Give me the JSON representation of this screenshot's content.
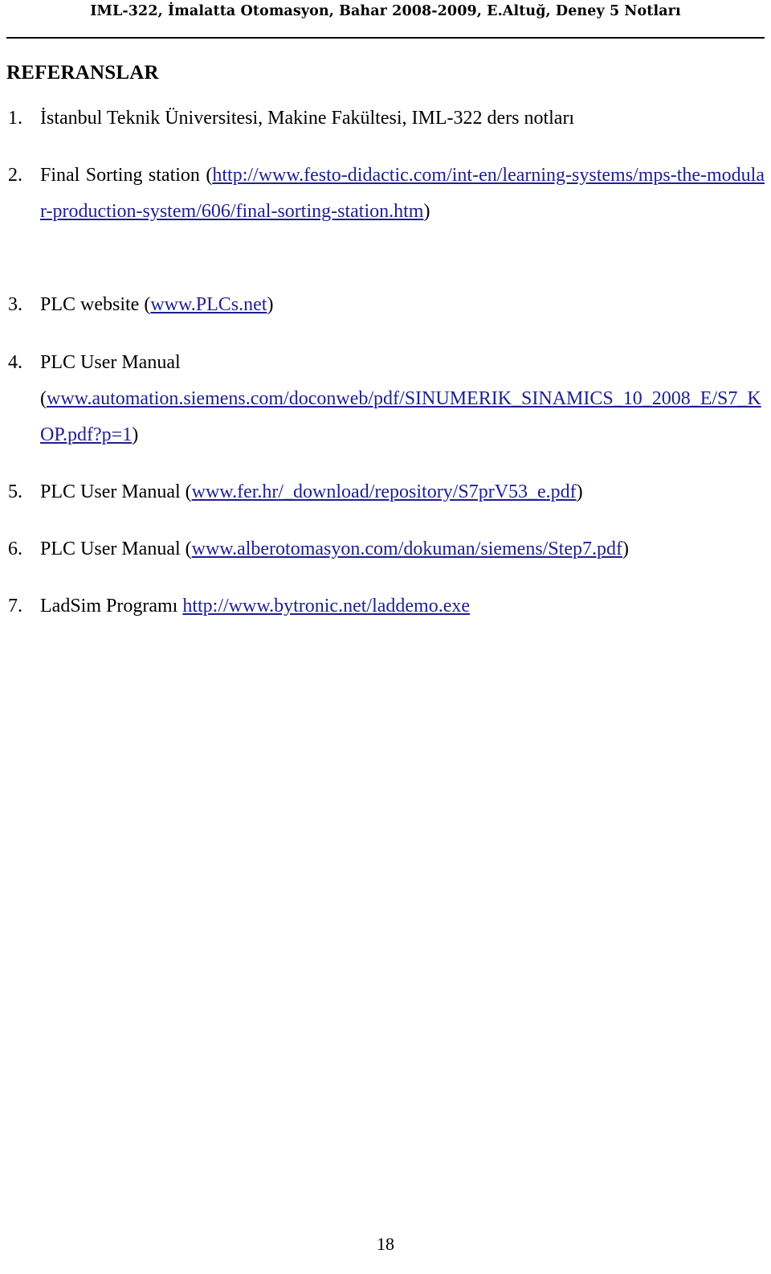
{
  "document": {
    "running_header": "IML-322, İmalatta Otomasyon, Bahar 2008-2009, E.Altuğ, Deney 5 Notları",
    "page_number": "18",
    "link_color": "#1f1f8f",
    "text_color": "#000000",
    "background_color": "#ffffff"
  },
  "section": {
    "title": "REFERANSLAR"
  },
  "references": [
    {
      "number": "1.",
      "text": "İstanbul Teknik Üniversitesi, Makine Fakültesi, IML-322 ders notları",
      "pre": "İstanbul Teknik Üniversitesi, Makine Fakültesi, IML-322 ders notları",
      "link": "",
      "post": ""
    },
    {
      "number": "2.",
      "pre": "Final Sorting station (",
      "link": "http://www.festo-didactic.com/int-en/learning-systems/mps-the-modular-production-system/606/final-sorting-station.htm",
      "post": ")"
    },
    {
      "number": "3.",
      "pre": "PLC website (",
      "link": "www.PLCs.net",
      "post": ")"
    },
    {
      "number": "4.",
      "pre": "PLC User Manual",
      "line2_open": "(",
      "link": "www.automation.siemens.com/doconweb/pdf/SINUMERIK_SINAMICS_10_2008_E/S7_KOP.pdf?p=1",
      "post": ")"
    },
    {
      "number": "5.",
      "pre": "PLC User Manual (",
      "link": "www.fer.hr/_download/repository/S7prV53_e.pdf",
      "post": ")"
    },
    {
      "number": "6.",
      "pre": "PLC User Manual (",
      "link": "www.alberotomasyon.com/dokuman/siemens/Step7.pdf",
      "post": ")"
    },
    {
      "number": "7.",
      "pre": "LadSim Programı ",
      "link": "http://www.bytronic.net/laddemo.exe",
      "post": ""
    }
  ]
}
